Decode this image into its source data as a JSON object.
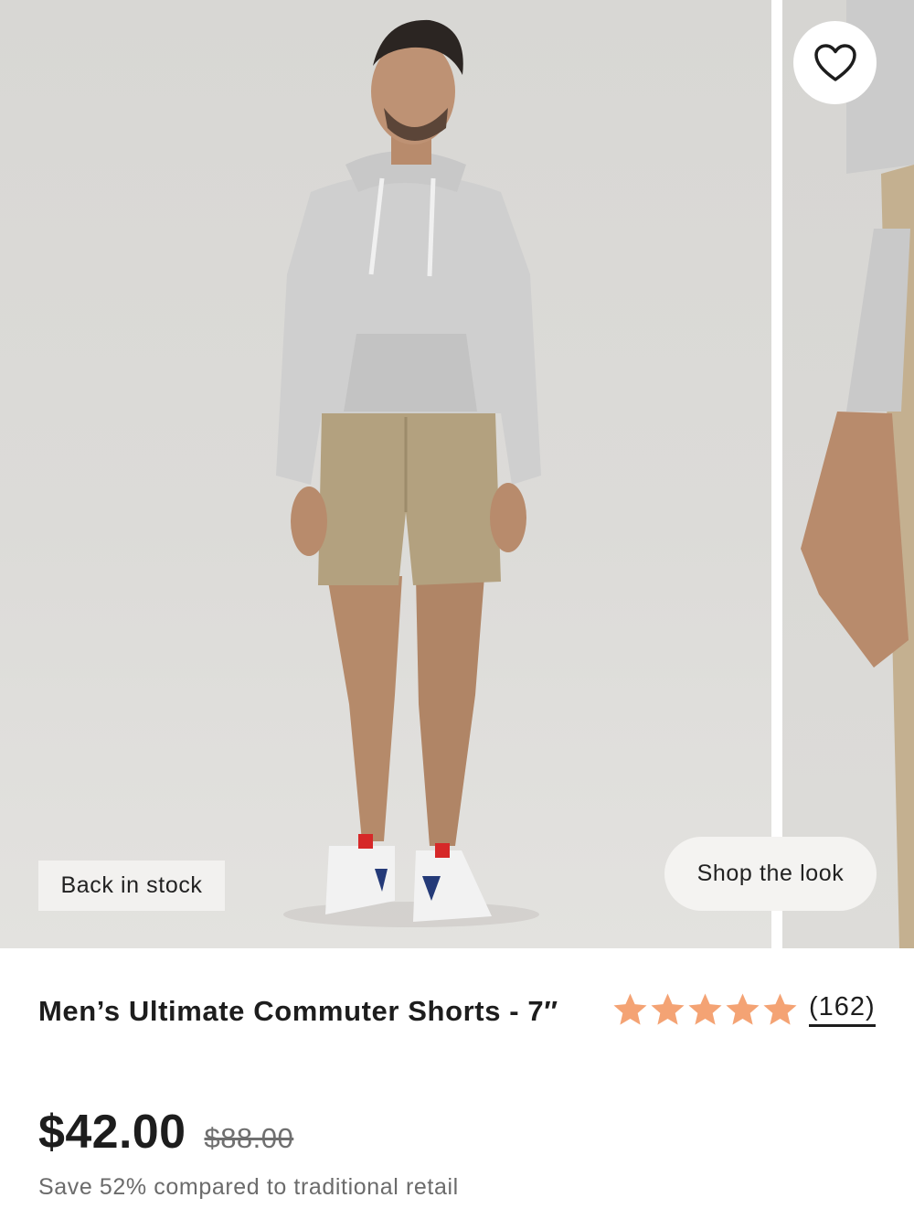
{
  "gallery": {
    "stock_badge": "Back in stock",
    "shop_the_look": "Shop the look",
    "favorite_icon": "heart-icon"
  },
  "product": {
    "title": "Men’s Ultimate Commuter Shorts - 7″",
    "rating": {
      "stars": 5,
      "star_color": "#f4a374",
      "review_count": "(162)"
    },
    "price": "$42.00",
    "original_price": "$88.00",
    "savings_note": "Save 52% compared to traditional retail"
  }
}
